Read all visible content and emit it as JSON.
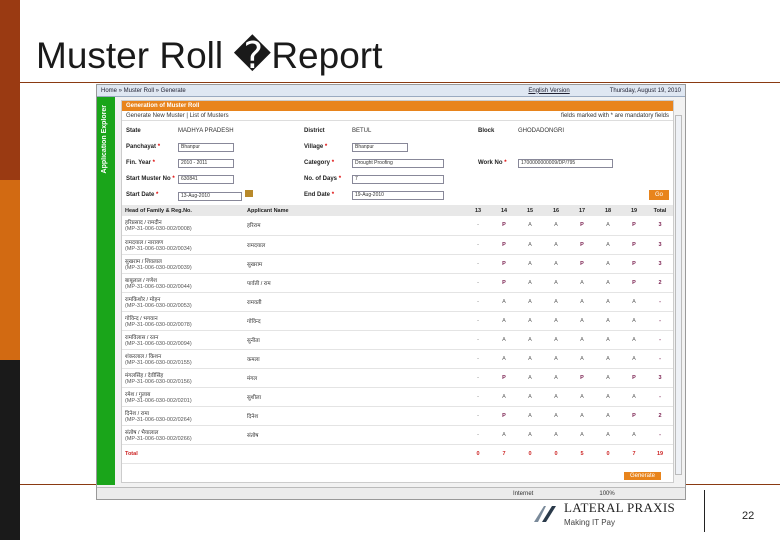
{
  "slide": {
    "title": "Muster Roll �Report",
    "page_number": "22"
  },
  "app": {
    "breadcrumb": "Home » Muster Roll » Generate",
    "language_link": "English Version",
    "date": "Thursday, August 19, 2010",
    "side_label": "Application Explorer",
    "header": "Generation of Muster Roll",
    "sub_left": "Generate New Muster | List of Musters",
    "sub_right": "fields marked with * are mandatory fields",
    "form": {
      "state_label": "State",
      "state_value": "MADHYA PRADESH",
      "district_label": "District",
      "district_value": "BETUL",
      "block_label": "Block",
      "block_value": "GHODADONGRI",
      "panchayat_label": "Panchayat",
      "panchayat_value": "Bhanpur",
      "village_label": "Village",
      "village_value": "Bhanpur",
      "finyear_label": "Fin. Year",
      "finyear_value": "2010 - 2011",
      "category_label": "Category",
      "category_value": "Drought Proofing",
      "workno_label": "Work No",
      "workno_value": "1700000000009/DP/795",
      "startmuster_label": "Start Muster No",
      "startmuster_value": "630841",
      "noofdays_label": "No. of Days",
      "noofdays_value": "7",
      "startdate_label": "Start Date",
      "startdate_value": "13-Aug-2010",
      "enddate_label": "End Date",
      "enddate_value": "19-Aug-2010",
      "go_label": "Go"
    },
    "grid": {
      "headers": [
        "Head of Family & Reg.No.",
        "Applicant Name",
        "13",
        "14",
        "15",
        "16",
        "17",
        "18",
        "19",
        "Total"
      ],
      "rows": [
        {
          "name": "हरिप्रसाद / रामदीन",
          "reg": "(MP-31-006-030-002/0008)",
          "applicant": "हरिराम",
          "days": [
            "-",
            "P",
            "A",
            "A",
            "P",
            "A",
            "P"
          ],
          "total": "3"
        },
        {
          "name": "रामदयाल / नारायण",
          "reg": "(MP-31-006-030-002/0034)",
          "applicant": "रामदयाल",
          "days": [
            "-",
            "P",
            "A",
            "A",
            "P",
            "A",
            "P"
          ],
          "total": "3"
        },
        {
          "name": "सुखराम / शिवलाल",
          "reg": "(MP-31-006-030-002/0039)",
          "applicant": "सुखराम",
          "days": [
            "-",
            "P",
            "A",
            "A",
            "P",
            "A",
            "P"
          ],
          "total": "3"
        },
        {
          "name": "बाबूलाल / गणेश",
          "reg": "(MP-31-006-030-002/0044)",
          "applicant": "पार्वती / राम",
          "days": [
            "-",
            "P",
            "A",
            "A",
            "A",
            "A",
            "P"
          ],
          "total": "2"
        },
        {
          "name": "रामकिशोर / मोहन",
          "reg": "(MP-31-006-030-002/0053)",
          "applicant": "रामवती",
          "days": [
            "-",
            "A",
            "A",
            "A",
            "A",
            "A",
            "A"
          ],
          "total": "-"
        },
        {
          "name": "गोविन्द / भगवान",
          "reg": "(MP-31-006-030-002/0078)",
          "applicant": "गोविन्द",
          "days": [
            "-",
            "A",
            "A",
            "A",
            "A",
            "A",
            "A"
          ],
          "total": "-"
        },
        {
          "name": "रामविलास / रतन",
          "reg": "(MP-31-006-030-002/0094)",
          "applicant": "सुनीता",
          "days": [
            "-",
            "A",
            "A",
            "A",
            "A",
            "A",
            "A"
          ],
          "total": "-"
        },
        {
          "name": "शंकरलाल / किशन",
          "reg": "(MP-31-006-030-002/0155)",
          "applicant": "कमला",
          "days": [
            "-",
            "A",
            "A",
            "A",
            "A",
            "A",
            "A"
          ],
          "total": "-"
        },
        {
          "name": "मंगलसिंह / देवीसिंह",
          "reg": "(MP-31-006-030-002/0156)",
          "applicant": "मंगल",
          "days": [
            "-",
            "P",
            "A",
            "A",
            "P",
            "A",
            "P"
          ],
          "total": "3"
        },
        {
          "name": "रमेश / गुलाब",
          "reg": "(MP-31-006-030-002/0201)",
          "applicant": "सुशीला",
          "days": [
            "-",
            "A",
            "A",
            "A",
            "A",
            "A",
            "A"
          ],
          "total": "-"
        },
        {
          "name": "दिनेश / रामा",
          "reg": "(MP-31-006-030-002/0264)",
          "applicant": "दिनेश",
          "days": [
            "-",
            "P",
            "A",
            "A",
            "A",
            "A",
            "P"
          ],
          "total": "2"
        },
        {
          "name": "संतोष / भैयालाल",
          "reg": "(MP-31-006-030-002/0266)",
          "applicant": "संतोष",
          "days": [
            "-",
            "A",
            "A",
            "A",
            "A",
            "A",
            "A"
          ],
          "total": "-"
        }
      ],
      "totals_label": "Total",
      "totals": [
        "0",
        "7",
        "0",
        "0",
        "5",
        "0",
        "7",
        "19"
      ]
    },
    "generate_label": "Generate",
    "status": {
      "zone": "Internet",
      "zoom": "100%"
    }
  },
  "footer": {
    "company": "LATERAL PRAXIS",
    "tagline": "Making IT Pay"
  },
  "colors": {
    "orange": "#e8841c",
    "green": "#1aa51a",
    "brown": "#9a3a12"
  }
}
